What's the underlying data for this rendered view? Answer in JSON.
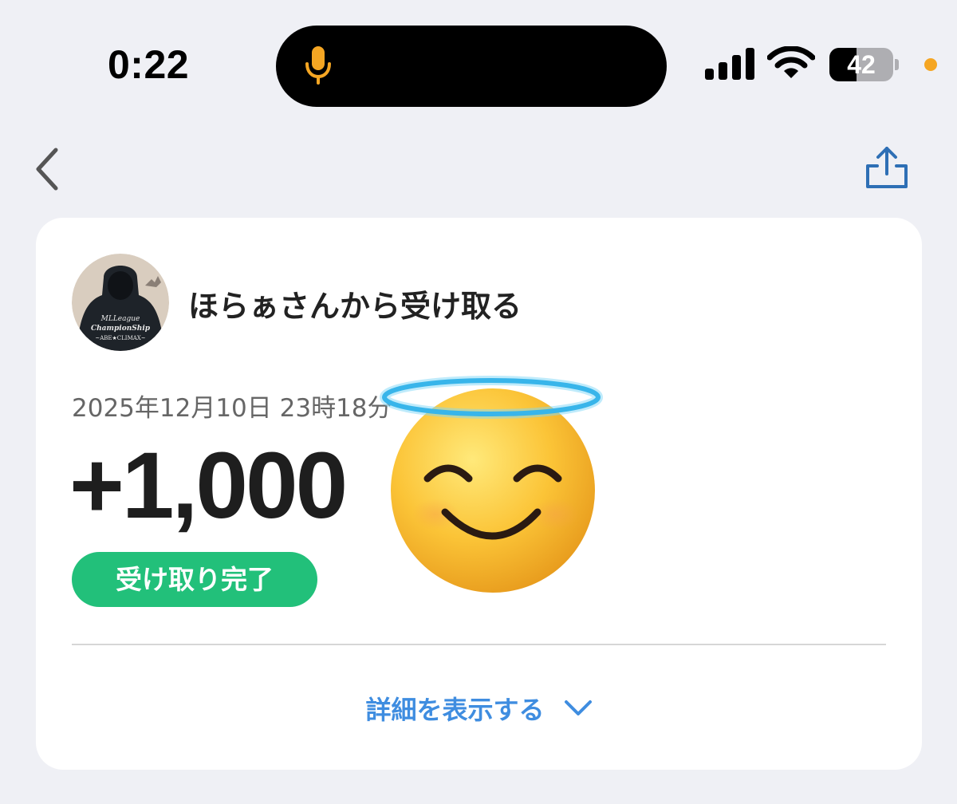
{
  "status_bar": {
    "time": "0:22",
    "battery_level": "42",
    "battery_fraction": 0.42,
    "icons": [
      "microphone-icon",
      "signal-icon",
      "wifi-icon",
      "battery-icon",
      "recording-dot"
    ]
  },
  "nav": {
    "back_icon": "chevron-left-icon",
    "share_icon": "share-icon"
  },
  "transaction": {
    "title": "ほらぁさんから受け取る",
    "datetime": "2025年12月10日 23時18分",
    "amount": "+1,000",
    "status": "受け取り完了",
    "details_label": "詳細を表示する",
    "avatar_text": [
      "MLLeague",
      "ChampionShip",
      "~ABE★CLIMAX~"
    ]
  },
  "colors": {
    "background": "#eff0f5",
    "accent_orange": "#f5a623",
    "status_green": "#22c07a",
    "link_blue": "#3f8de0",
    "share_blue": "#2e6fb5"
  },
  "sticker": "smiling-face-with-halo-emoji"
}
